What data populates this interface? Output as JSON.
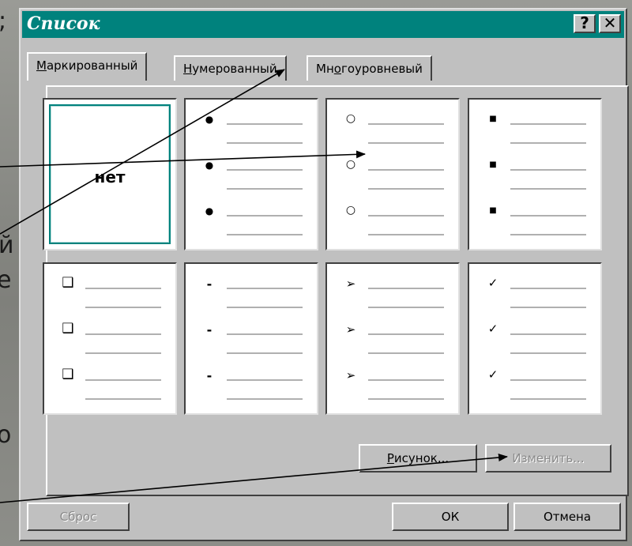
{
  "background": {
    "left_text_fragments": [
      ";",
      "й",
      "е",
      "о"
    ]
  },
  "dialog": {
    "title": "Список",
    "help_label": "?",
    "close_label": "✕",
    "tabs": [
      {
        "pre": "",
        "key": "М",
        "post": "аркированный"
      },
      {
        "pre": "",
        "key": "Н",
        "post": "умерованный"
      },
      {
        "pre": "Мн",
        "key": "о",
        "post": "гоуровневый"
      }
    ],
    "none_label": "нет",
    "bullet_styles": [
      "none",
      "filled-dot",
      "hollow-circle",
      "filled-square",
      "hollow-box",
      "dash",
      "arrowhead",
      "checkmark"
    ],
    "bullets": {
      "dot": "●",
      "circle": "○",
      "square": "■",
      "box": "❑",
      "dash": "-",
      "arrow": "➢",
      "check": "✓"
    },
    "buttons": {
      "picture": {
        "key": "Р",
        "rest": "исунок..."
      },
      "modify": "Изменить...",
      "reset": "Сброс",
      "ok": "ОК",
      "cancel": "Отмена"
    }
  },
  "colors": {
    "titlebar": "#00827d",
    "dialog_face": "#c0c0c0",
    "selection": "#00827d"
  }
}
